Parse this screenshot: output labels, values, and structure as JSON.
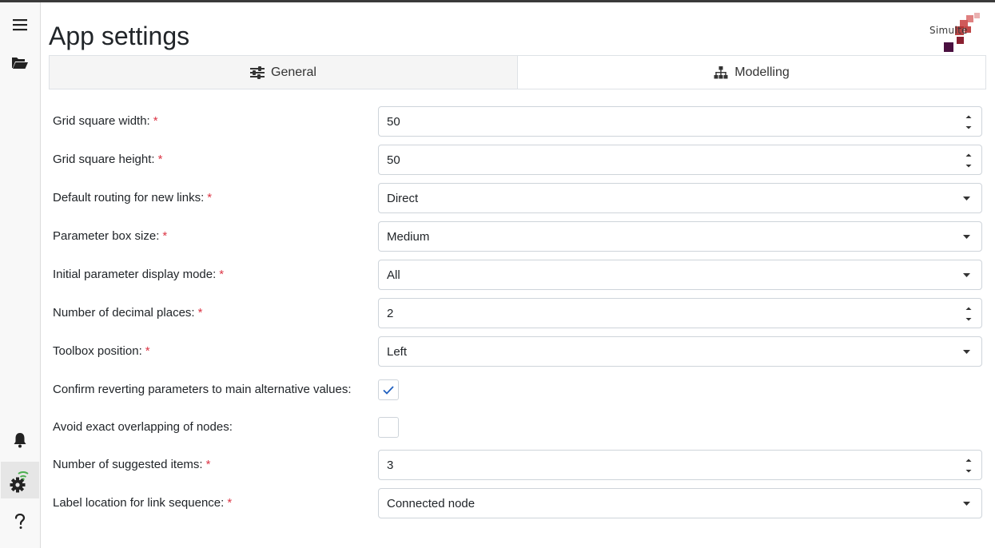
{
  "app": {
    "title": "App settings",
    "logo_text": "Simulte",
    "brand_colors": [
      "#e8a0a0",
      "#d05a5a",
      "#b03030",
      "#7a2030",
      "#4a1040"
    ]
  },
  "sidebar": {
    "items": [
      {
        "name": "menu-icon"
      },
      {
        "name": "folder-open-icon"
      },
      {
        "name": "bell-icon"
      },
      {
        "name": "settings-icon",
        "active": true
      },
      {
        "name": "help-icon"
      }
    ]
  },
  "tabs": [
    {
      "label": "General",
      "icon": "sliders-icon",
      "active": true
    },
    {
      "label": "Modelling",
      "icon": "sitemap-icon",
      "active": false
    }
  ],
  "form": {
    "required_mark": "*",
    "fields": [
      {
        "label": "Grid square width:",
        "type": "number",
        "value": "50",
        "required": true
      },
      {
        "label": "Grid square height:",
        "type": "number",
        "value": "50",
        "required": true
      },
      {
        "label": "Default routing for new links:",
        "type": "select",
        "value": "Direct",
        "required": true
      },
      {
        "label": "Parameter box size:",
        "type": "select",
        "value": "Medium",
        "required": true
      },
      {
        "label": "Initial parameter display mode:",
        "type": "select",
        "value": "All",
        "required": true
      },
      {
        "label": "Number of decimal places:",
        "type": "number",
        "value": "2",
        "required": true
      },
      {
        "label": "Toolbox position:",
        "type": "select",
        "value": "Left",
        "required": true
      },
      {
        "label": "Confirm reverting parameters to main alternative values:",
        "type": "checkbox",
        "checked": true,
        "required": false
      },
      {
        "label": "Avoid exact overlapping of nodes:",
        "type": "checkbox",
        "checked": false,
        "required": false
      },
      {
        "label": "Number of suggested items:",
        "type": "number",
        "value": "3",
        "required": true
      },
      {
        "label": "Label location for link sequence:",
        "type": "select",
        "value": "Connected node",
        "required": true
      }
    ]
  },
  "colors": {
    "required": "#dc3545",
    "check": "#1f5fbf",
    "wifi_accent": "#4caf50"
  }
}
